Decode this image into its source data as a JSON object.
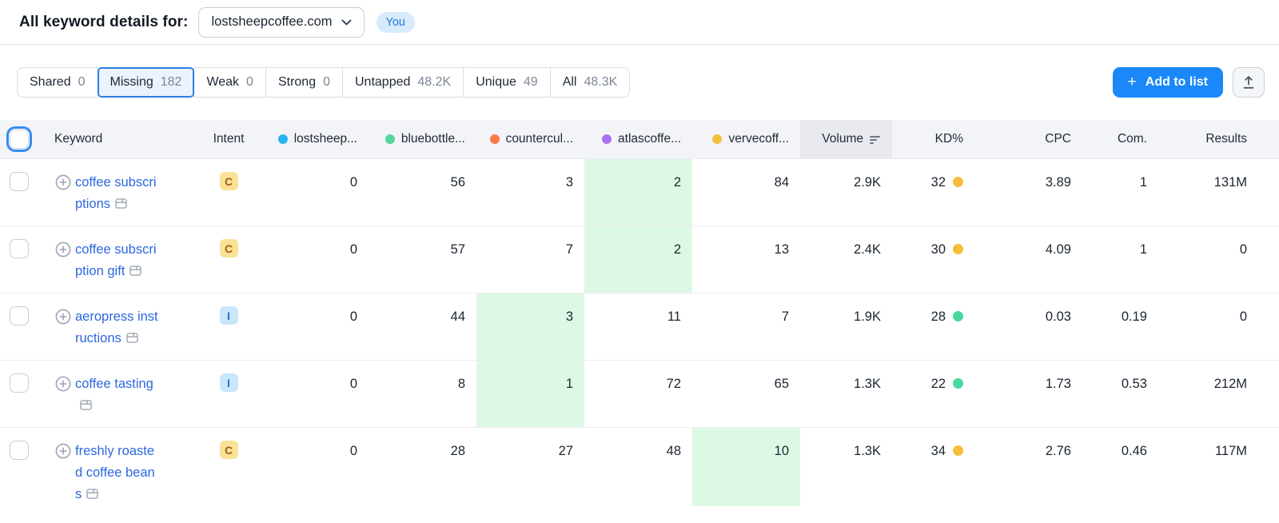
{
  "page": {
    "title": "All keyword details for:",
    "domain_selector": {
      "value": "lostsheepcoffee.com"
    },
    "you_badge": "You"
  },
  "toolbar": {
    "tabs": [
      {
        "label": "Shared",
        "count": "0",
        "active": false
      },
      {
        "label": "Missing",
        "count": "182",
        "active": true
      },
      {
        "label": "Weak",
        "count": "0",
        "active": false
      },
      {
        "label": "Strong",
        "count": "0",
        "active": false
      },
      {
        "label": "Untapped",
        "count": "48.2K",
        "active": false
      },
      {
        "label": "Unique",
        "count": "49",
        "active": false
      },
      {
        "label": "All",
        "count": "48.3K",
        "active": false
      }
    ],
    "add_to_list": {
      "plus": "+",
      "label": "Add to list"
    },
    "export_icon": "export-upload-icon"
  },
  "table": {
    "headers": {
      "keyword": "Keyword",
      "intent": "Intent",
      "volume": "Volume",
      "kd": "KD%",
      "cpc": "CPC",
      "com": "Com.",
      "results": "Results"
    },
    "sorted_column": "Volume",
    "sort_direction": "descending",
    "competitors": [
      {
        "label": "lostsheep...",
        "dot_color": "#29B2F2"
      },
      {
        "label": "bluebottle...",
        "dot_color": "#51D79F"
      },
      {
        "label": "countercul...",
        "dot_color": "#FB7A4B"
      },
      {
        "label": "atlascoffe...",
        "dot_color": "#AC70F4"
      },
      {
        "label": "vervecoff...",
        "dot_color": "#F4C03C"
      }
    ],
    "rows": [
      {
        "keyword": "coffee subscriptions",
        "intent": "C",
        "positions": [
          "0",
          "56",
          "3",
          "2",
          "84"
        ],
        "highlight": 3,
        "volume": "2.9K",
        "kd": "32",
        "kd_level": "possible",
        "cpc": "3.89",
        "com": "1",
        "results": "131M"
      },
      {
        "keyword": "coffee subscription gift",
        "intent": "C",
        "positions": [
          "0",
          "57",
          "7",
          "2",
          "13"
        ],
        "highlight": 3,
        "volume": "2.4K",
        "kd": "30",
        "kd_level": "possible",
        "cpc": "4.09",
        "com": "1",
        "results": "0"
      },
      {
        "keyword": "aeropress instructions",
        "intent": "I",
        "positions": [
          "0",
          "44",
          "3",
          "11",
          "7"
        ],
        "highlight": 2,
        "volume": "1.9K",
        "kd": "28",
        "kd_level": "easy",
        "cpc": "0.03",
        "com": "0.19",
        "results": "0"
      },
      {
        "keyword": "coffee tasting",
        "intent": "I",
        "positions": [
          "0",
          "8",
          "1",
          "72",
          "65"
        ],
        "highlight": 2,
        "volume": "1.3K",
        "kd": "22",
        "kd_level": "easy",
        "cpc": "1.73",
        "com": "0.53",
        "results": "212M"
      },
      {
        "keyword": "freshly roasted coffee beans",
        "intent": "C",
        "positions": [
          "0",
          "28",
          "27",
          "48",
          "10"
        ],
        "highlight": 4,
        "volume": "1.3K",
        "kd": "34",
        "kd_level": "possible",
        "cpc": "2.76",
        "com": "0.46",
        "results": "117M"
      }
    ]
  },
  "colors": {
    "accent_blue": "#1A88F8",
    "link_blue": "#2C67E0",
    "highlight_green": "#DEF8E6",
    "kd_levels": {
      "easy": "#49D89E",
      "possible": "#F6BD3A"
    },
    "intent_badges": {
      "C": {
        "bg": "#F9E297",
        "fg": "#A35F0C"
      },
      "I": {
        "bg": "#C9E7FB",
        "fg": "#2A70CF"
      }
    }
  }
}
